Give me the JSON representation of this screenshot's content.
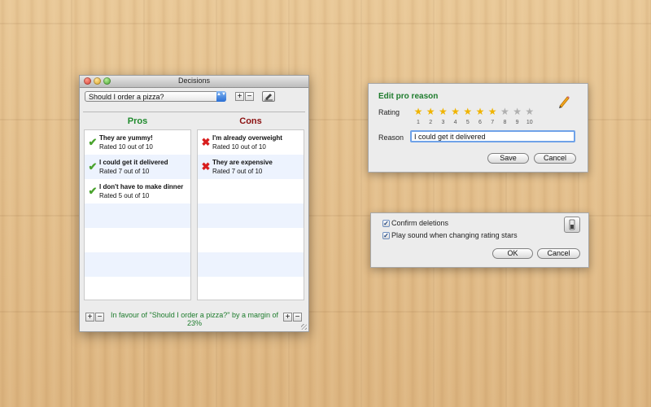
{
  "main_window": {
    "title": "Decisions",
    "decision_select": "Should I order a pizza?",
    "select_arrows": "▲▼",
    "add_label": "+",
    "remove_label": "−",
    "pros_header": "Pros",
    "cons_header": "Cons",
    "pros_color": "#1e8a2c",
    "cons_color": "#8b1010",
    "pros": [
      {
        "title": "They are yummy!",
        "rating": "Rated 10 out of 10"
      },
      {
        "title": "I could get it delivered",
        "rating": "Rated 7 out of 10"
      },
      {
        "title": "I don't have to make dinner",
        "rating": "Rated 5 out of 10"
      }
    ],
    "cons": [
      {
        "title": "I'm already overweight",
        "rating": "Rated 10 out of 10"
      },
      {
        "title": "They are expensive",
        "rating": "Rated 7 out of 10"
      }
    ],
    "status": "In favour of \"Should I order a pizza?\" by a margin of 23%"
  },
  "edit_dialog": {
    "title": "Edit pro reason",
    "rating_label": "Rating",
    "rating_value": 7,
    "rating_max": 10,
    "star_numbers": [
      "1",
      "2",
      "3",
      "4",
      "5",
      "6",
      "7",
      "8",
      "9",
      "10"
    ],
    "reason_label": "Reason",
    "reason_value": "I could get it delivered",
    "save_label": "Save",
    "cancel_label": "Cancel",
    "icon": "pencil-icon"
  },
  "settings_dialog": {
    "confirm_deletions_label": "Confirm deletions",
    "confirm_deletions_checked": true,
    "play_sound_label": "Play sound when changing rating stars",
    "play_sound_checked": true,
    "ok_label": "OK",
    "cancel_label": "Cancel",
    "icon": "switch-icon"
  }
}
